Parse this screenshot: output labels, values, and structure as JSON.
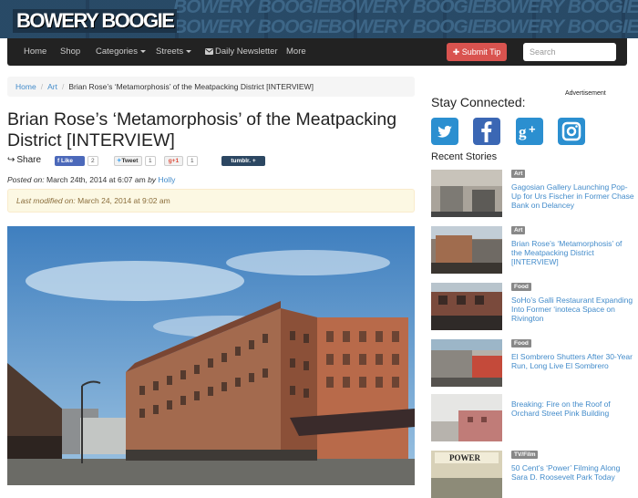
{
  "brand": {
    "logo": "BOWERY BOOGIE",
    "bg_color": "#1c3348"
  },
  "nav": {
    "items": [
      {
        "label": "Home"
      },
      {
        "label": "Shop"
      },
      {
        "label": "Categories"
      },
      {
        "label": "Streets"
      },
      {
        "label": "Daily Newsletter",
        "icon": "envelope-icon"
      },
      {
        "label": "More"
      }
    ],
    "submit_tip": "Submit Tip",
    "search_placeholder": "Search"
  },
  "breadcrumb": {
    "home": "Home",
    "section": "Art",
    "current": "Brian Rose’s ‘Metamorphosis’ of the Meatpacking District [INTERVIEW]"
  },
  "article": {
    "title": "Brian Rose’s ‘Metamorphosis’ of the Meatpacking District [INTERVIEW]",
    "share_label": "Share",
    "like_label": "Like",
    "like_count": "2",
    "tweet_label": "Tweet",
    "tweet_count": "1",
    "gplus_label": "g+1",
    "gplus_count": "1",
    "tumblr_label": "tumblr. +",
    "posted_prefix": "Posted on:",
    "posted_date": "March 24th, 2014 at 6:07 am",
    "by": "by",
    "author": "Holly",
    "modified_prefix": "Last modified on:",
    "modified_date": "March 24, 2014 at 9:02 am"
  },
  "sidebar": {
    "stay_connected": "Stay Connected:",
    "advertisement": "Advertisement",
    "social": [
      {
        "name": "twitter",
        "icon": "twitter-icon",
        "glyph": "t"
      },
      {
        "name": "facebook",
        "icon": "facebook-icon",
        "glyph": "f"
      },
      {
        "name": "google-plus",
        "icon": "google-plus-icon",
        "glyph": "g+"
      },
      {
        "name": "instagram",
        "icon": "instagram-icon",
        "glyph": "◎"
      }
    ],
    "recent_heading": "Recent Stories",
    "stories": [
      {
        "tag": "Art",
        "title": "Gagosian Gallery Launching Pop-Up for Urs Fischer in Former Chase Bank on Delancey"
      },
      {
        "tag": "Art",
        "title": "Brian Rose’s ‘Metamorphosis’ of the Meatpacking District [INTERVIEW]"
      },
      {
        "tag": "Food",
        "title": "SoHo’s Galli Restaurant Expanding Into Former ‘inoteca Space on Rivington"
      },
      {
        "tag": "Food",
        "title": "El Sombrero Shutters After 30-Year Run, Long Live El Sombrero"
      },
      {
        "tag": "",
        "title": "Breaking: Fire on the Roof of Orchard Street Pink Building"
      },
      {
        "tag": "TV/Film",
        "title": "50 Cent’s ‘Power’ Filming Along Sara D. Roosevelt Park Today"
      }
    ]
  },
  "colors": {
    "link": "#428bca",
    "submit": "#d9534f",
    "twitter": "#2b8fd0",
    "facebook": "#3b67b4",
    "gplus": "#2b8fd0",
    "instagram": "#2b8fd0"
  }
}
